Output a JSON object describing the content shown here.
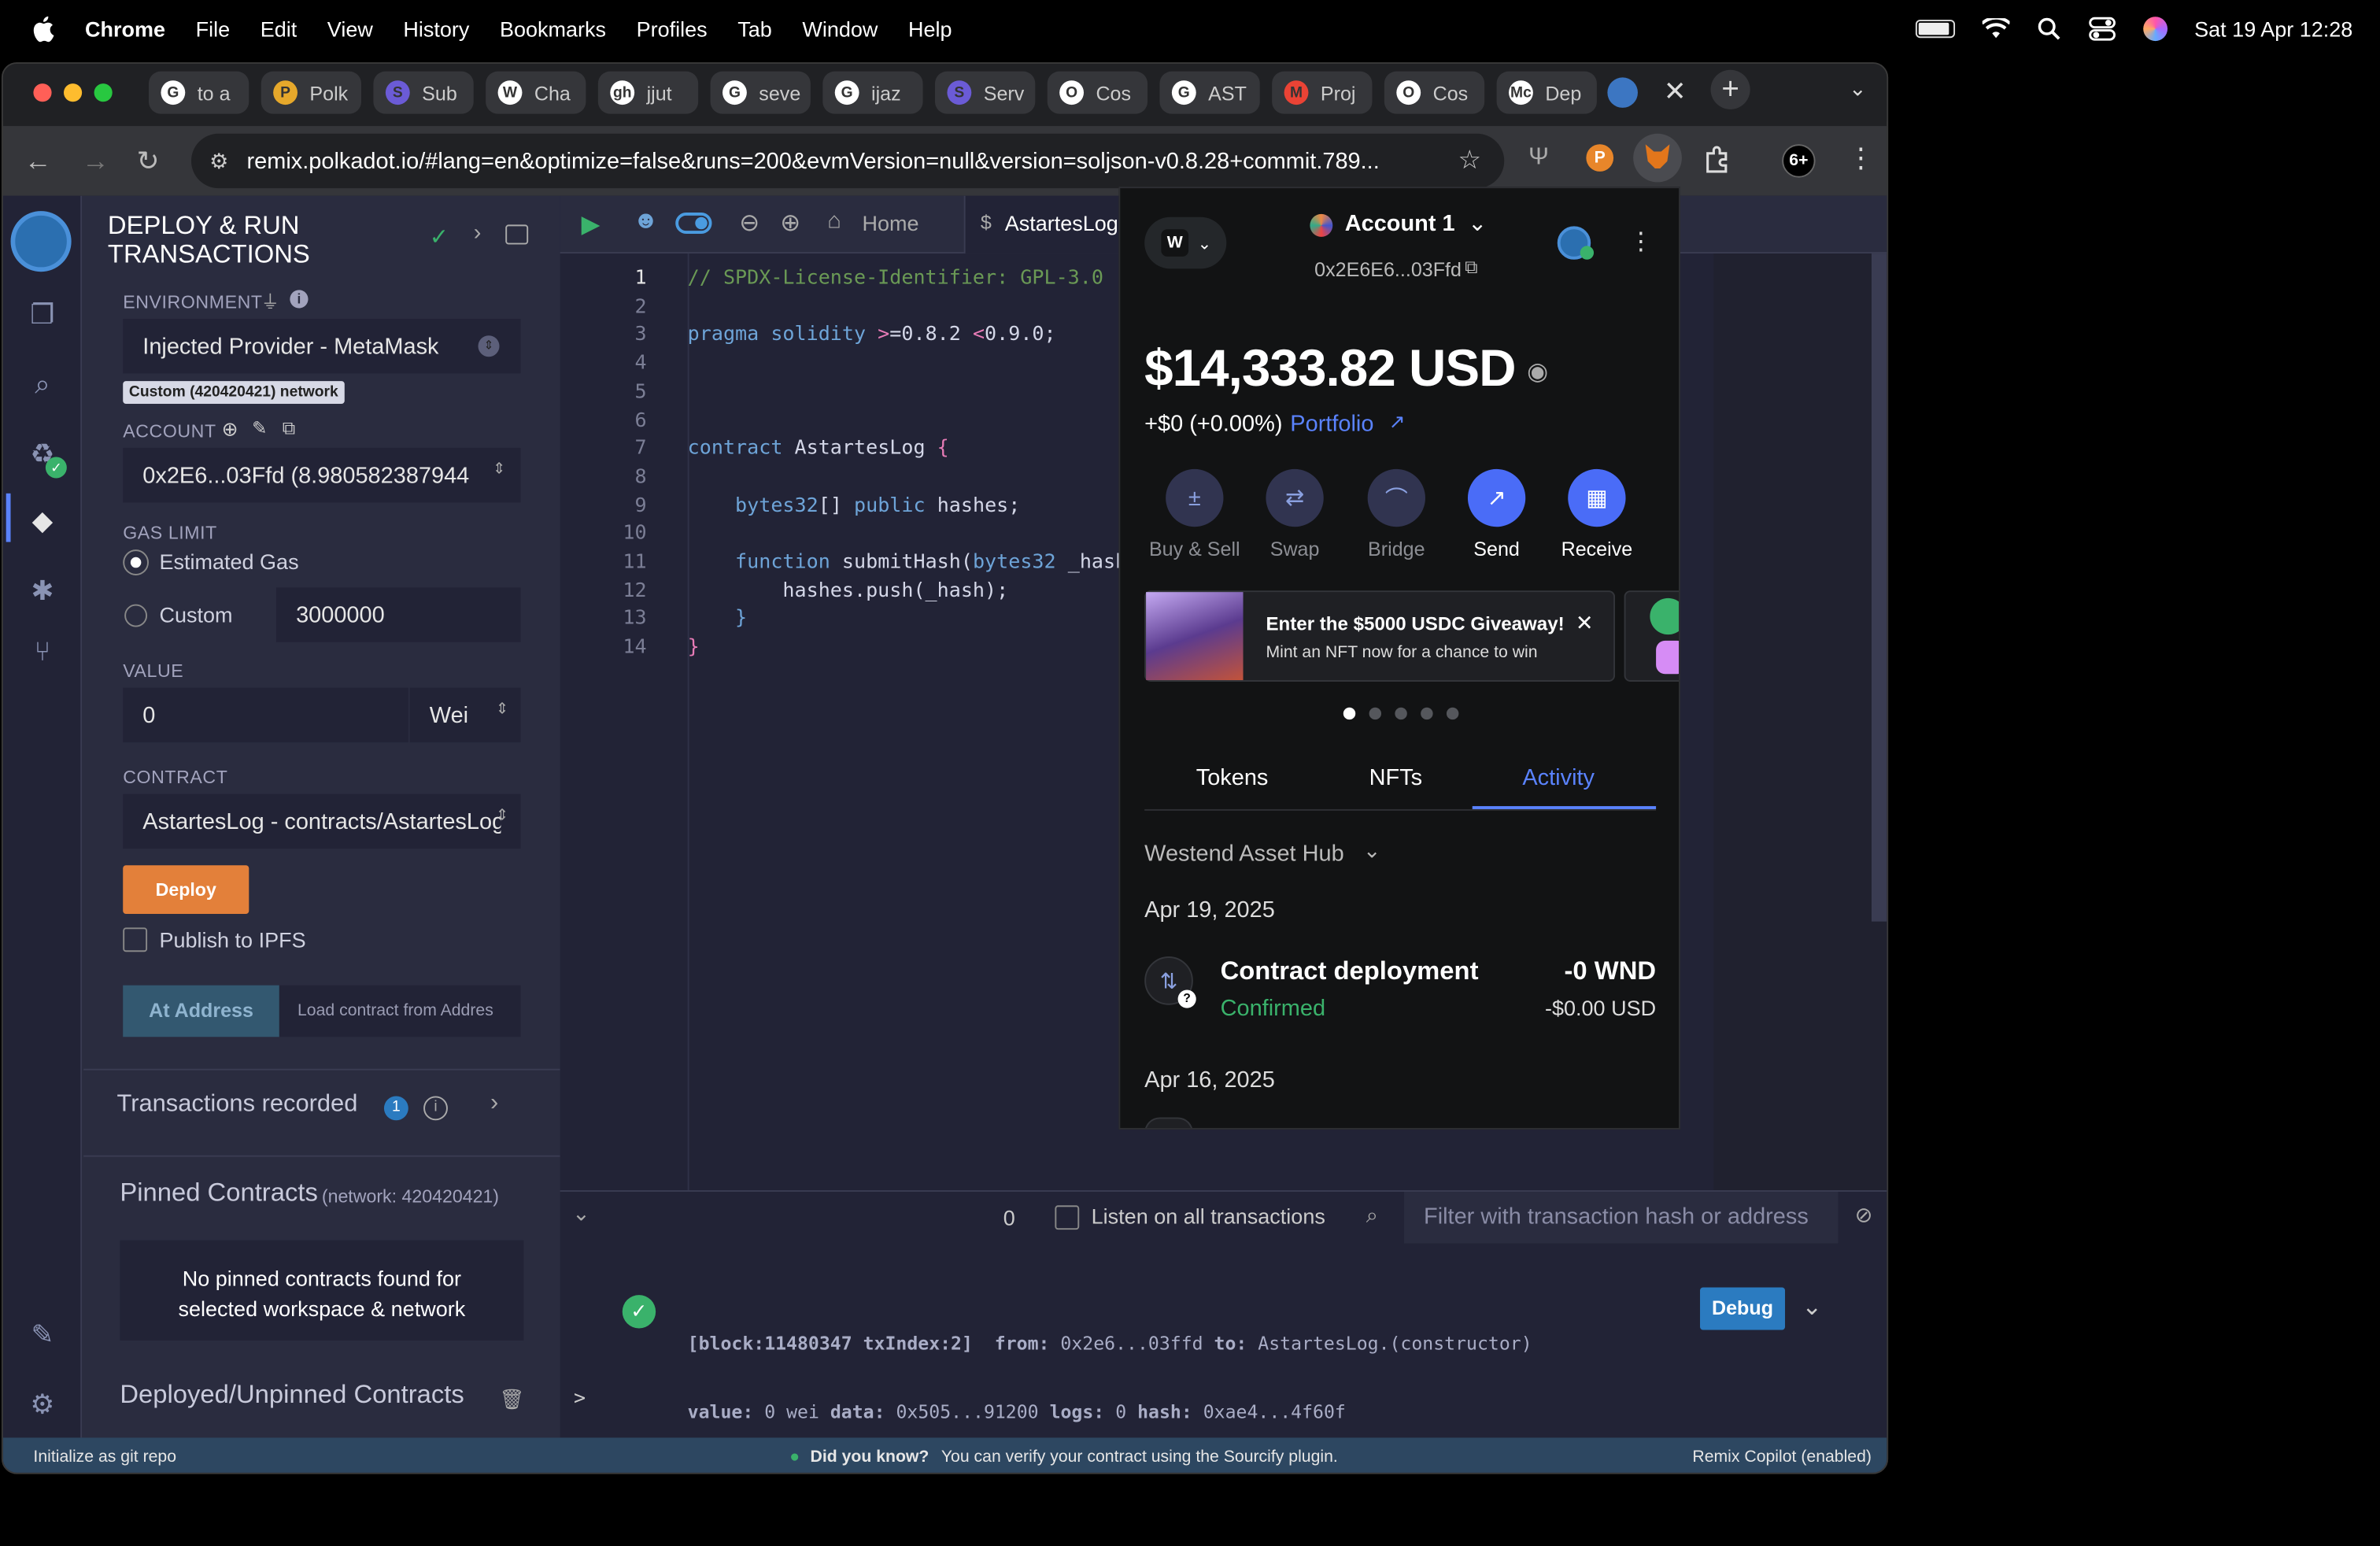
{
  "menubar": {
    "app": "Chrome",
    "items": [
      "File",
      "Edit",
      "View",
      "History",
      "Bookmarks",
      "Profiles",
      "Tab",
      "Window",
      "Help"
    ],
    "datetime": "Sat 19 Apr  12:28"
  },
  "tabs": [
    {
      "title": "to a",
      "icon": "G"
    },
    {
      "title": "Polk",
      "icon": "P"
    },
    {
      "title": "Sub",
      "icon": "S"
    },
    {
      "title": "Cha",
      "icon": "W"
    },
    {
      "title": "jjut",
      "icon": "gh"
    },
    {
      "title": "seve",
      "icon": "G"
    },
    {
      "title": "ijaz",
      "icon": "G"
    },
    {
      "title": "Serv",
      "icon": "S"
    },
    {
      "title": "Cos",
      "icon": "O"
    },
    {
      "title": "AST",
      "icon": "G"
    },
    {
      "title": "Proj",
      "icon": "M"
    },
    {
      "title": "Cos",
      "icon": "O"
    },
    {
      "title": "Dep",
      "icon": "Mc"
    }
  ],
  "url": "remix.polkadot.io/#lang=en&optimize=false&runs=200&evmVersion=null&version=soljson-v0.8.28+commit.789...",
  "ext_badge": "6+",
  "panel": {
    "title_line1": "DEPLOY & RUN",
    "title_line2": "TRANSACTIONS",
    "environment_label": "ENVIRONMENT",
    "environment_value": "Injected Provider - MetaMask",
    "network_badge": "Custom (420420421) network",
    "account_label": "ACCOUNT",
    "account_value": "0x2E6...03Ffd (8.980582387944",
    "gas_label": "GAS LIMIT",
    "gas_estimated": "Estimated Gas",
    "gas_custom": "Custom",
    "gas_custom_value": "3000000",
    "value_label": "VALUE",
    "value_value": "0",
    "value_unit": "Wei",
    "contract_label": "CONTRACT",
    "contract_value": "AstartesLog - contracts/AstartesLog",
    "deploy_label": "Deploy",
    "publish_label": "Publish to IPFS",
    "at_address_label": "At Address",
    "load_contract_placeholder": "Load contract from Addres",
    "tx_recorded": "Transactions recorded",
    "tx_count": "1",
    "pinned_title": "Pinned Contracts",
    "pinned_network": "(network: 420420421)",
    "no_pinned_1": "No pinned contracts found for",
    "no_pinned_2": "selected workspace & network",
    "deployed_title": "Deployed/Unpinned Contracts"
  },
  "editor": {
    "home_tab": "Home",
    "file_tab": "AstartesLog.",
    "line_numbers": [
      "1",
      "2",
      "3",
      "4",
      "5",
      "6",
      "7",
      "8",
      "9",
      "10",
      "11",
      "12",
      "13",
      "14"
    ]
  },
  "terminal": {
    "count": "0",
    "listen_label": "Listen on all transactions",
    "filter_placeholder": "Filter with transaction hash or address",
    "log_line1_k1": "[block:11480347 txIndex:2]",
    "log_line1_k2": "from:",
    "log_line1_v2": "0x2e6...03ffd",
    "log_line1_k3": "to:",
    "log_line1_v3": "AstartesLog.(constructor)",
    "log_line2_k1": "value:",
    "log_line2_v1": "0 wei",
    "log_line2_k2": "data:",
    "log_line2_v2": "0x505...91200",
    "log_line2_k3": "logs:",
    "log_line2_v3": "0",
    "log_line2_k4": "hash:",
    "log_line2_v4": "0xae4...4f60f",
    "debug_label": "Debug",
    "prompt": ">"
  },
  "status": {
    "left": "Initialize as git repo",
    "tip_bold": "Did you know?",
    "tip": "You can verify your contract using the Sourcify plugin.",
    "right": "Remix Copilot (enabled)"
  },
  "metamask": {
    "net_letter": "W",
    "account_name": "Account 1",
    "address": "0x2E6E6...03Ffd",
    "balance": "$14,333.82 USD",
    "change": "+$0 (+0.00%)",
    "portfolio": "Portfolio",
    "actions": [
      "Buy & Sell",
      "Swap",
      "Bridge",
      "Send",
      "Receive"
    ],
    "promo_title": "Enter the $5000 USDC Giveaway!",
    "promo_sub": "Mint an NFT now for a chance to win",
    "tabs": [
      "Tokens",
      "NFTs",
      "Activity"
    ],
    "network_filter": "Westend Asset Hub",
    "date1": "Apr 19, 2025",
    "tx_title": "Contract deployment",
    "tx_status": "Confirmed",
    "tx_amount": "-0 WND",
    "tx_usd": "-$0.00 USD",
    "date2": "Apr 16, 2025"
  },
  "colors": {
    "accent_blue": "#5a83ff",
    "remix_bg": "#2a2c3f",
    "deploy_orange": "#e3803a",
    "status_bar": "#2d4761",
    "confirmed_green": "#3ab26b"
  }
}
